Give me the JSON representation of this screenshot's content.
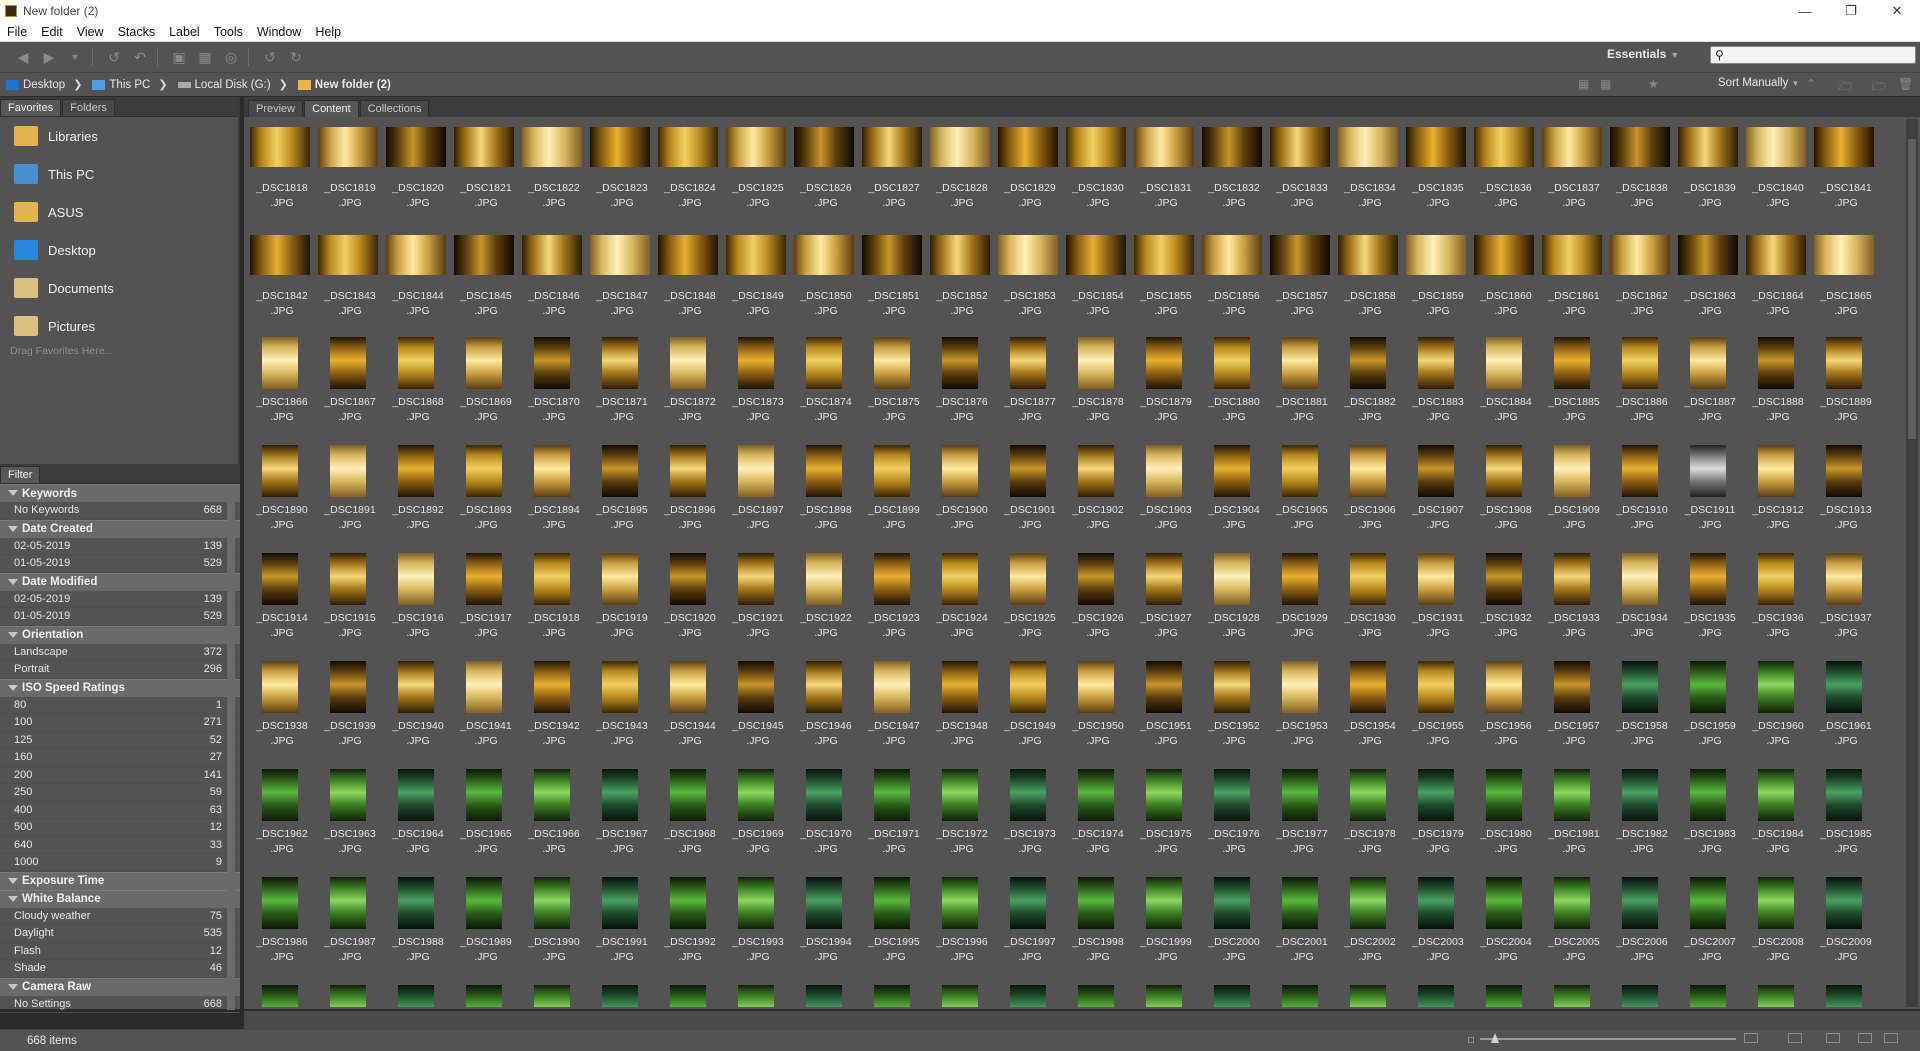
{
  "window": {
    "title": "New folder (2)"
  },
  "menu": [
    "File",
    "Edit",
    "View",
    "Stacks",
    "Label",
    "Tools",
    "Window",
    "Help"
  ],
  "toolbar": {
    "workspace": "Essentials"
  },
  "path": [
    {
      "label": "Desktop",
      "color": "#1e73d6"
    },
    {
      "label": "This PC",
      "color": "#4aa0e0"
    },
    {
      "label": "Local Disk (G:)",
      "color": "#aaaaaa"
    },
    {
      "label": "New folder (2)",
      "color": "#e8b64a"
    }
  ],
  "sort": {
    "label": "Sort Manually"
  },
  "left_tabs": [
    "Favorites",
    "Folders"
  ],
  "favorites": [
    {
      "label": "Libraries",
      "icon": "libraries-icon",
      "color": "#e0b44a"
    },
    {
      "label": "This PC",
      "icon": "computer-icon",
      "color": "#4a8fd0"
    },
    {
      "label": "ASUS",
      "icon": "user-folder-icon",
      "color": "#e0b44a"
    },
    {
      "label": "Desktop",
      "icon": "desktop-icon",
      "color": "#2a86e0"
    },
    {
      "label": "Documents",
      "icon": "documents-icon",
      "color": "#d8c080"
    },
    {
      "label": "Pictures",
      "icon": "pictures-icon",
      "color": "#d8c080"
    }
  ],
  "favorites_hint": "Drag Favorites Here...",
  "filter": {
    "tab": "Filter",
    "sections": [
      {
        "title": "Keywords",
        "rows": [
          [
            "No Keywords",
            "668"
          ]
        ]
      },
      {
        "title": "Date Created",
        "rows": [
          [
            "02-05-2019",
            "139"
          ],
          [
            "01-05-2019",
            "529"
          ]
        ]
      },
      {
        "title": "Date Modified",
        "rows": [
          [
            "02-05-2019",
            "139"
          ],
          [
            "01-05-2019",
            "529"
          ]
        ]
      },
      {
        "title": "Orientation",
        "rows": [
          [
            "Landscape",
            "372"
          ],
          [
            "Portrait",
            "296"
          ]
        ]
      },
      {
        "title": "ISO Speed Ratings",
        "rows": [
          [
            "80",
            "1"
          ],
          [
            "100",
            "271"
          ],
          [
            "125",
            "52"
          ],
          [
            "160",
            "27"
          ],
          [
            "200",
            "141"
          ],
          [
            "250",
            "59"
          ],
          [
            "400",
            "63"
          ],
          [
            "500",
            "12"
          ],
          [
            "640",
            "33"
          ],
          [
            "1000",
            "9"
          ]
        ]
      },
      {
        "title": "Exposure Time",
        "rows": []
      },
      {
        "title": "White Balance",
        "rows": [
          [
            "Cloudy weather",
            "75"
          ],
          [
            "Daylight",
            "535"
          ],
          [
            "Flash",
            "12"
          ],
          [
            "Shade",
            "46"
          ]
        ]
      },
      {
        "title": "Camera Raw",
        "rows": [
          [
            "No Settings",
            "668"
          ]
        ]
      }
    ]
  },
  "content_tabs": [
    "Preview",
    "Content",
    "Collections"
  ],
  "grid": {
    "first_number": 1818,
    "columns": 24,
    "rows": 9,
    "prefix": "_DSC",
    "ext": ".JPG"
  },
  "status": {
    "count": "668 items"
  }
}
